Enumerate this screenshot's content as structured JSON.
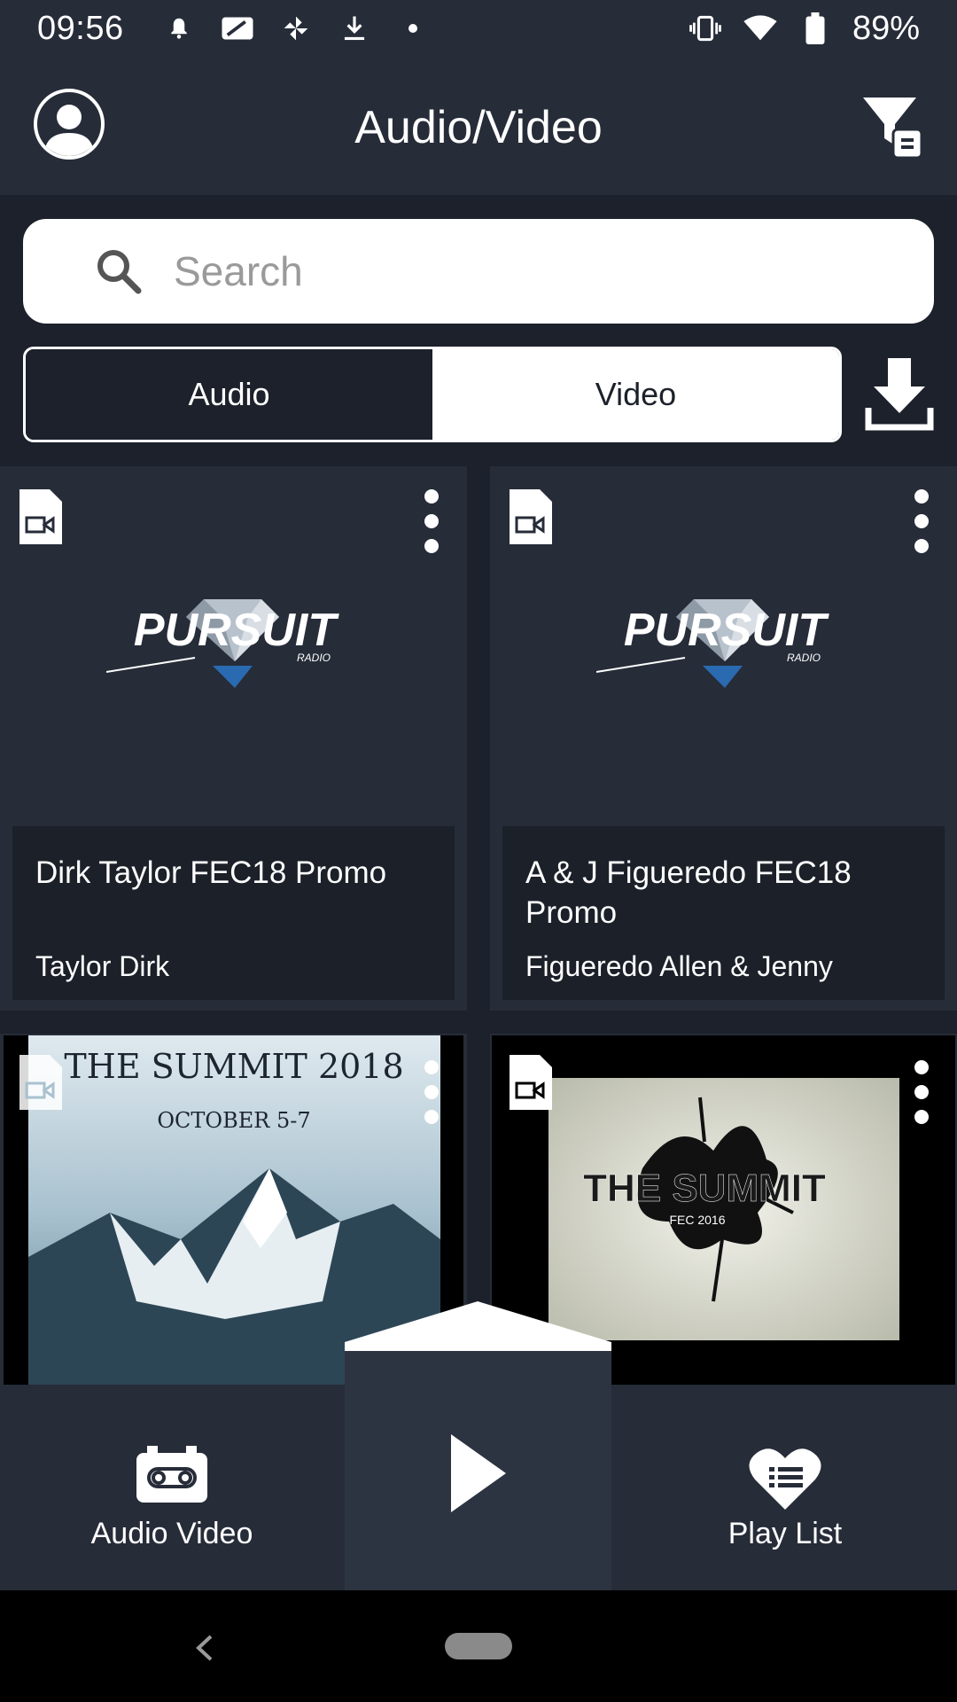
{
  "status_bar": {
    "time": "09:56",
    "battery": "89%",
    "icons": [
      "alarm-icon",
      "cast-icon",
      "pinwheel-icon",
      "download-icon",
      "dot-icon",
      "vibrate-icon",
      "wifi-icon",
      "battery-icon"
    ]
  },
  "header": {
    "title": "Audio/Video",
    "left_icon": "avatar-icon",
    "right_icon": "filter-icon"
  },
  "search": {
    "placeholder": "Search",
    "value": ""
  },
  "segment": {
    "tabs": [
      {
        "label": "Audio",
        "selected": false
      },
      {
        "label": "Video",
        "selected": true
      }
    ]
  },
  "cards": [
    {
      "title": "Dirk Taylor FEC18 Promo",
      "subtitle": "Taylor Dirk",
      "logo_title": "PURSUIT",
      "logo_sub": "RADIO"
    },
    {
      "title": "A & J Figueredo FEC18 Promo",
      "subtitle": "Figueredo  Allen & Jenny",
      "logo_title": "PURSUIT",
      "logo_sub": "RADIO"
    },
    {
      "title": "",
      "subtitle": "",
      "thumb_title": "THE SUMMIT 2018",
      "thumb_sub": "OCTOBER 5-7"
    },
    {
      "title": "",
      "subtitle": "",
      "thumb_title": "THE SUMMIT",
      "thumb_sub": "FEC 2016"
    }
  ],
  "bottom_nav": {
    "items": [
      {
        "label": "Audio Video",
        "icon": "cassette-icon"
      },
      {
        "label": "",
        "icon": "play-icon"
      },
      {
        "label": "Play List",
        "icon": "heart-list-icon"
      }
    ]
  },
  "colors": {
    "background": "#1c212b",
    "surface": "#262c38",
    "accent": "#ffffff"
  }
}
